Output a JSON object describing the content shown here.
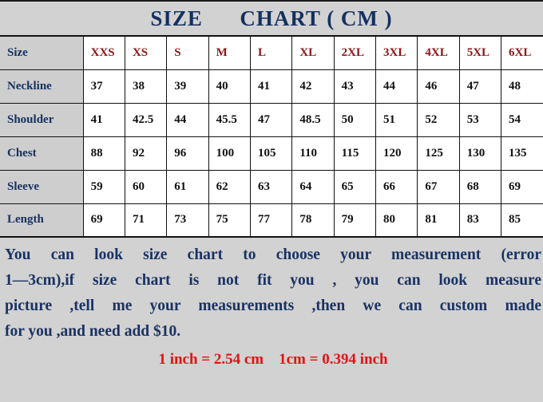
{
  "document": {
    "title": "SIZE      CHART ( CM )",
    "unit": "CM"
  },
  "colors": {
    "background": "#d2d2d2",
    "title_navy": "#15305f",
    "label_navy": "#15305f",
    "size_header_red": "#8c1616",
    "conversion_red": "#e81010",
    "note_navy": "#1a3263",
    "label_cell_gray": "#cecece",
    "cell_white": "#ffffff",
    "border": "#111111"
  },
  "table": {
    "corner_label": "Size",
    "sizes": [
      "XXS",
      "XS",
      "S",
      "M",
      "L",
      "XL",
      "2XL",
      "3XL",
      "4XL",
      "5XL",
      "6XL"
    ],
    "rows": [
      {
        "label": "Neckline",
        "values": [
          "37",
          "38",
          "39",
          "40",
          "41",
          "42",
          "43",
          "44",
          "46",
          "47",
          "48"
        ]
      },
      {
        "label": "Shoulder",
        "values": [
          "41",
          "42.5",
          "44",
          "45.5",
          "47",
          "48.5",
          "50",
          "51",
          "52",
          "53",
          "54"
        ]
      },
      {
        "label": "Chest",
        "values": [
          "88",
          "92",
          "96",
          "100",
          "105",
          "110",
          "115",
          "120",
          "125",
          "130",
          "135"
        ]
      },
      {
        "label": "Sleeve",
        "values": [
          "59",
          "60",
          "61",
          "62",
          "63",
          "64",
          "65",
          "66",
          "67",
          "68",
          "69"
        ]
      },
      {
        "label": "Length",
        "values": [
          "69",
          "71",
          "73",
          "75",
          "77",
          "78",
          "79",
          "80",
          "81",
          "83",
          "85"
        ]
      }
    ]
  },
  "note": {
    "lines": [
      "You can look size chart to choose your measurement (error",
      "1—3cm),if size chart is not fit you , you can look measure",
      "picture ,tell me your measurements ,then we can custom made",
      "for you ,and need add $10."
    ],
    "conversion": "1 inch = 2.54 cm    1cm = 0.394 inch"
  }
}
